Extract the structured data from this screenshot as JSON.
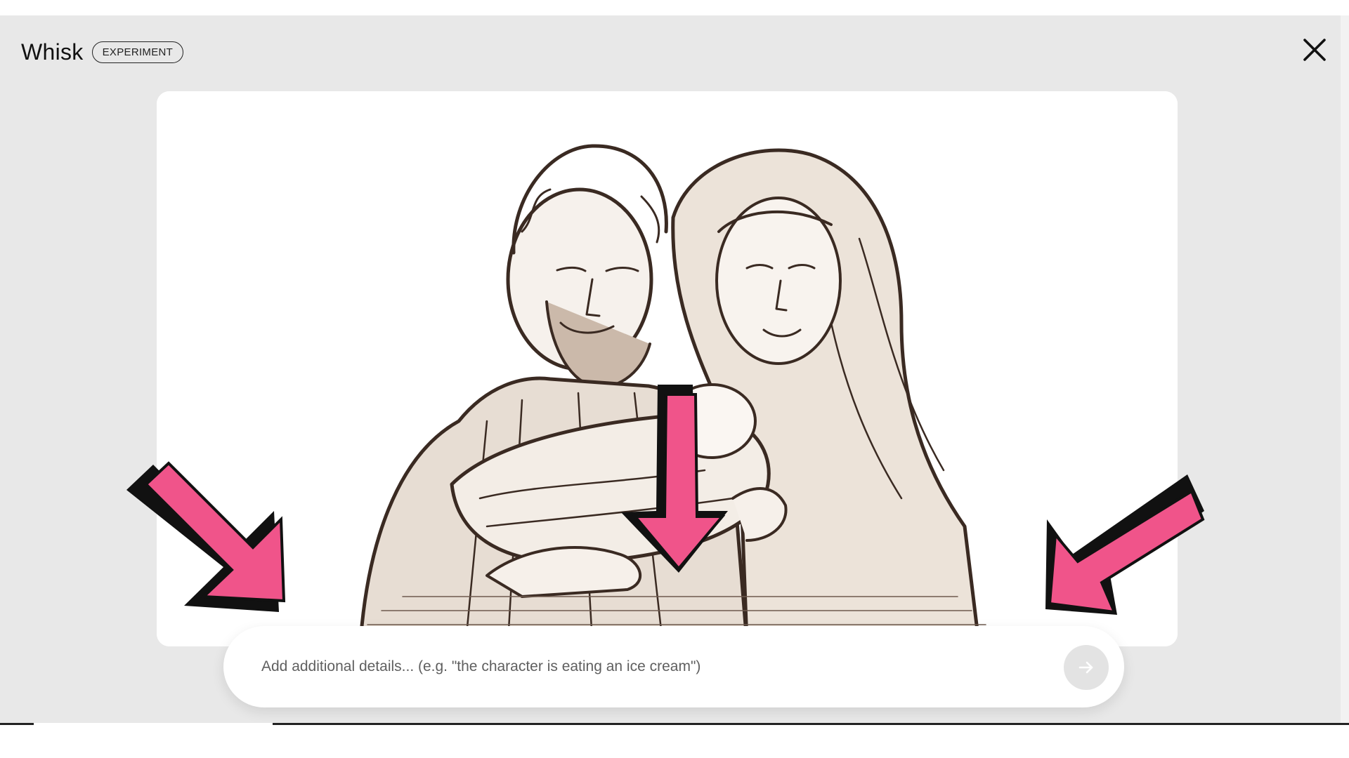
{
  "app": {
    "title": "Whisk",
    "badge": "EXPERIMENT"
  },
  "header": {
    "close_icon": "close-icon"
  },
  "main": {
    "image": {
      "subject": "engraving-style illustration",
      "icon": "generated-image"
    }
  },
  "prompt": {
    "placeholder": "Add additional details... (e.g. \"the character is eating an ice cream\")",
    "value": "",
    "submit_icon": "arrow-right-icon"
  },
  "annotations": {
    "arrow_color": "#f0548a",
    "arrow_shadow": "#111111",
    "count": 3
  },
  "colors": {
    "dialog_background": "#e8e8e8",
    "card_background": "#ffffff",
    "submit_disabled": "#e3e3e3",
    "text": "#111111"
  }
}
